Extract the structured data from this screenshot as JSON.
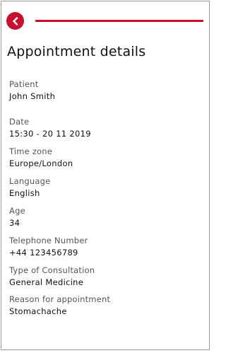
{
  "header": {
    "back_icon": "chevron-left-icon",
    "accent_color": "#c8102e"
  },
  "page": {
    "title": "Appointment details"
  },
  "fields": {
    "patient": {
      "label": "Patient",
      "value": "John Smith"
    },
    "date": {
      "label": "Date",
      "value": "15:30 - 20 11 2019"
    },
    "time_zone": {
      "label": "Time zone",
      "value": "Europe/London"
    },
    "language": {
      "label": "Language",
      "value": "English"
    },
    "age": {
      "label": "Age",
      "value": "34"
    },
    "telephone": {
      "label": "Telephone Number",
      "value": "+44 123456789"
    },
    "consultation_type": {
      "label": "Type of Consultation",
      "value": "General Medicine"
    },
    "reason": {
      "label": "Reason for appointment",
      "value": "Stomachache"
    }
  }
}
